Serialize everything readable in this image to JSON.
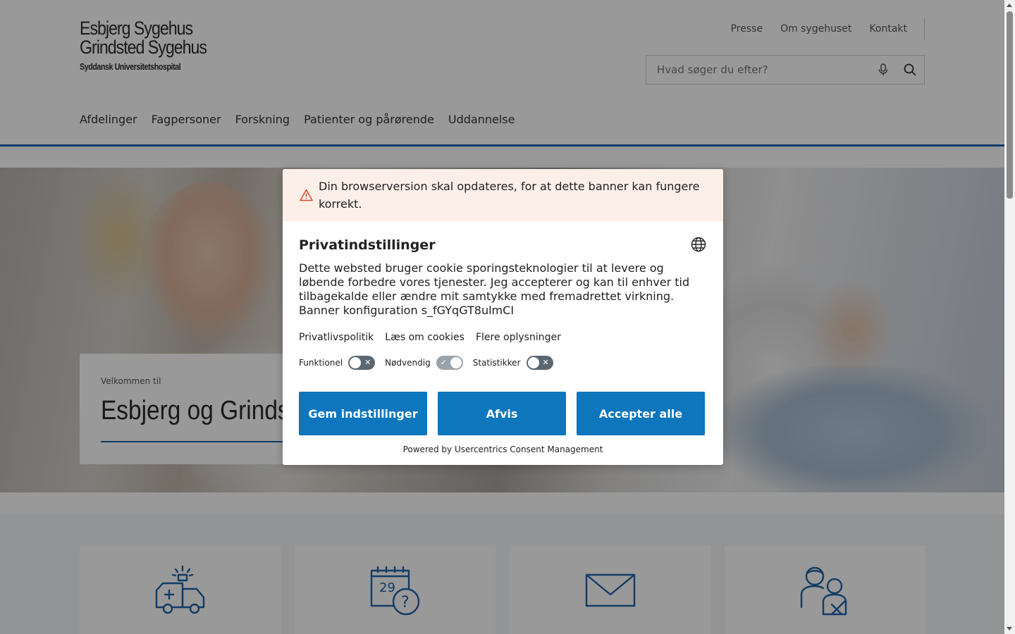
{
  "logo": {
    "line1": "Esbjerg Sygehus",
    "line2": "Grindsted Sygehus",
    "line3": "Syddansk Universitetshospital"
  },
  "top_links": [
    "Presse",
    "Om sygehuset",
    "Kontakt"
  ],
  "search": {
    "placeholder": "Hvad søger du efter?",
    "mic_icon": "microphone-icon",
    "search_icon": "magnifier-icon"
  },
  "main_nav": [
    "Afdelinger",
    "Fagpersoner",
    "Forskning",
    "Patienter og pårørende",
    "Uddannelse"
  ],
  "hero": {
    "pre_title": "Velkommen til",
    "title": "Esbjerg og Grindsted Sygehus"
  },
  "cards": [
    {
      "icon": "ambulance-icon"
    },
    {
      "icon": "calendar-question-icon"
    },
    {
      "icon": "envelope-icon"
    },
    {
      "icon": "doctor-patient-icon"
    }
  ],
  "consent": {
    "warning_icon": "warning-triangle-icon",
    "warning_text": "Din browserversion skal opdateres, for at dette banner kan fungere korrekt.",
    "title": "Privatindstillinger",
    "language_icon": "globe-icon",
    "description": "Dette websted bruger cookie sporingsteknologier til at levere og løbende forbedre vores tjenester. Jeg accepterer og kan til enhver tid tilbagekalde eller ændre mit samtykke med fremadrettet virkning. Banner konfiguration s_fGYqGT8ulmCI",
    "links": [
      "Privatlivspolitik",
      "Læs om cookies",
      "Flere oplysninger"
    ],
    "toggles": [
      {
        "label": "Funktionel",
        "state": "off"
      },
      {
        "label": "Nødvendig",
        "state": "on"
      },
      {
        "label": "Statistikker",
        "state": "off"
      }
    ],
    "buttons": {
      "save": "Gem indstillinger",
      "deny": "Afvis",
      "accept": "Accepter alle"
    },
    "powered_by": "Powered by Usercentrics Consent Management",
    "colors": {
      "button": "#0d76bd",
      "warning_bg": "#fcefe8"
    }
  }
}
